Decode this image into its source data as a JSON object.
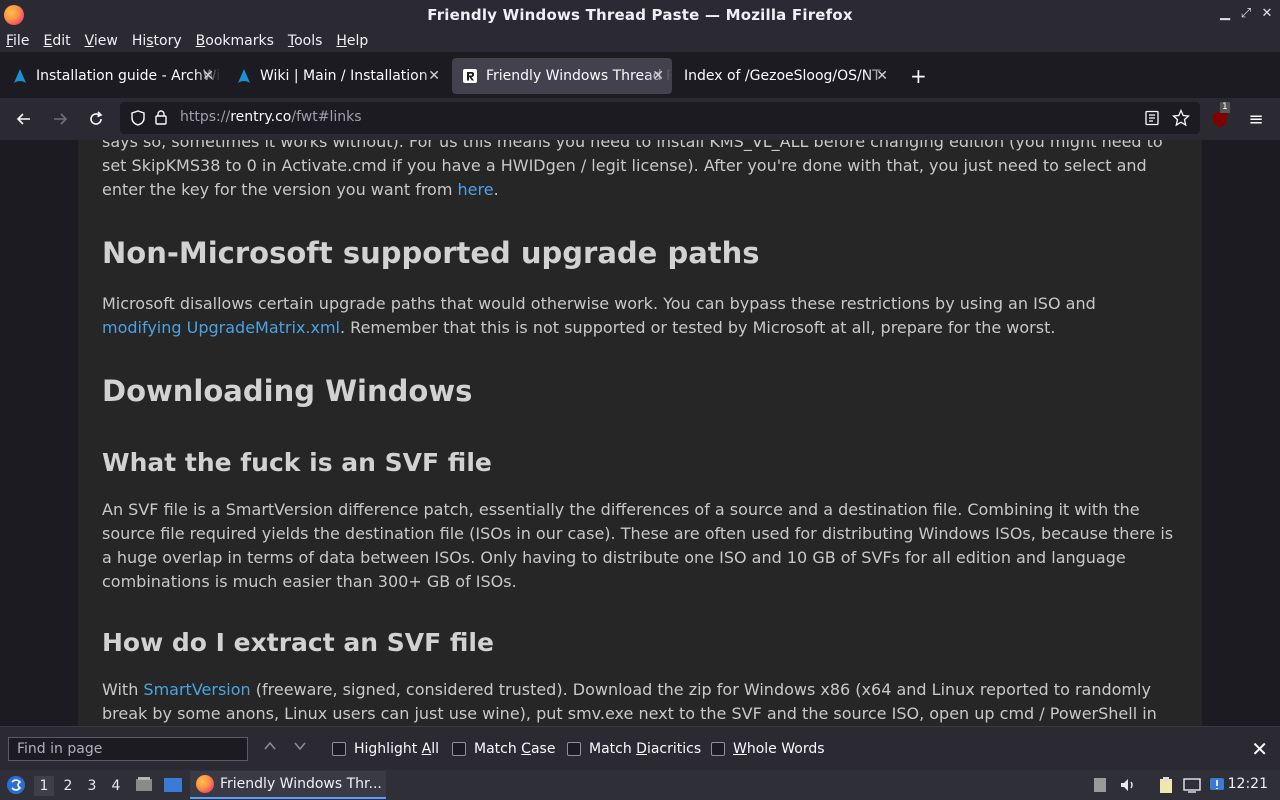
{
  "window": {
    "title": "Friendly Windows Thread Paste — Mozilla Firefox"
  },
  "menubar": [
    {
      "pre": "",
      "key": "F",
      "post": "ile"
    },
    {
      "pre": "",
      "key": "E",
      "post": "dit"
    },
    {
      "pre": "",
      "key": "V",
      "post": "iew"
    },
    {
      "pre": "Hi",
      "key": "s",
      "post": "tory"
    },
    {
      "pre": "",
      "key": "B",
      "post": "ookmarks"
    },
    {
      "pre": "",
      "key": "T",
      "post": "ools"
    },
    {
      "pre": "",
      "key": "H",
      "post": "elp"
    }
  ],
  "tabs": [
    {
      "label": "Installation guide - ArchWiki",
      "icon": "archlinux-icon",
      "active": false
    },
    {
      "label": "Wiki | Main / Installation",
      "icon": "archlinux-icon",
      "active": false
    },
    {
      "label": "Friendly Windows Thread Paste",
      "icon": "rentry-icon",
      "active": true
    },
    {
      "label": "Index of /GezoeSloog/OS/NT",
      "icon": "",
      "active": false
    }
  ],
  "navbar": {
    "url_prefix": "https://",
    "url_host": "rentry.co",
    "url_path": "/fwt#links"
  },
  "article": {
    "para0_lines": [
      "says so, sometimes it works without). For us this means you need to install KMS_VL_ALL before changing edition (you might need to",
      "set SkipKMS38 to 0 in Activate.cmd if you have a HWIDgen / legit license). After you're done with that, you just need to select and"
    ],
    "para0_last": "enter the key for the version you want from ",
    "para0_link": "here",
    "para0_end": ".",
    "h_upgrade": "Non-Microsoft supported upgrade paths",
    "para1_line1": "Microsoft disallows certain upgrade paths that would otherwise work. You can bypass these restrictions by using an ISO and",
    "para1_link": "modifying UpgradeMatrix.xml",
    "para1_rest": ". Remember that this is not supported or tested by Microsoft at all, prepare for the worst.",
    "h_downloading": "Downloading Windows",
    "h_svf": "What the fuck is an SVF file",
    "para2_lines": [
      "An SVF file is a SmartVersion difference patch, essentially the differences of a source and a destination file. Combining it with the",
      "source file required yields the destination file (ISOs in our case). These are often used for distributing Windows ISOs, because there is",
      "a huge overlap in terms of data between ISOs. Only having to distribute one ISO and 10 GB of SVFs for all edition and language",
      "combinations is much easier than 300+ GB of ISOs."
    ],
    "h_extract": "How do I extract an SVF file",
    "para3_pre": "With ",
    "para3_link": "SmartVersion",
    "para3_line1_rest": " (freeware, signed, considered trusted). Download the zip for Windows x86 (x64 and Linux reported to randomly",
    "para3_line2": "break by some anons, Linux users can just use wine), put smv.exe next to the SVF and the source ISO, open up cmd / PowerShell in"
  },
  "findbar": {
    "placeholder": "Find in page",
    "options": [
      {
        "label": "Highlight All",
        "underline_index": 10
      },
      {
        "label": "Match Case",
        "underline_index": 6
      },
      {
        "label": "Match Diacritics",
        "underline_index": 6
      },
      {
        "label": "Whole Words",
        "underline_index": 0
      }
    ]
  },
  "taskbar": {
    "workspaces": [
      "1",
      "2",
      "3",
      "4"
    ],
    "task_label": "Friendly Windows Thr...",
    "clock": "12:21"
  },
  "colors": {
    "link": "#4ba3e3",
    "chrome": "#2b2a33",
    "page_bg": "#262626"
  }
}
